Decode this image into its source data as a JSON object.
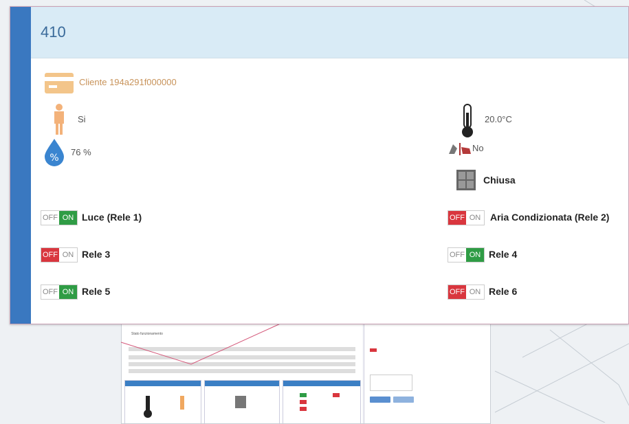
{
  "card": {
    "title": "410",
    "client": "Cliente 194a291f000000",
    "presence": "Si",
    "temperature": "20.0°C",
    "humidity": "76 %",
    "window_open": "No",
    "door_state": "Chiusa"
  },
  "relays": [
    {
      "off": "OFF",
      "on": "ON",
      "label": "Luce (Rele 1)",
      "state": "on"
    },
    {
      "off": "OFF",
      "on": "ON",
      "label": "Aria Condizionata (Rele 2)",
      "state": "off"
    },
    {
      "off": "OFF",
      "on": "ON",
      "label": "Rele 3",
      "state": "off"
    },
    {
      "off": "OFF",
      "on": "ON",
      "label": "Rele 4",
      "state": "on"
    },
    {
      "off": "OFF",
      "on": "ON",
      "label": "Rele 5",
      "state": "on"
    },
    {
      "off": "OFF",
      "on": "ON",
      "label": "Rele 6",
      "state": "off"
    }
  ],
  "colors": {
    "accent": "#3a78c0",
    "header_bg": "#d9ebf6",
    "off_red": "#d9363e",
    "on_green": "#2f9c45"
  },
  "icons": [
    "card-icon",
    "person-icon",
    "thermometer-icon",
    "humidity-drop-icon",
    "window-icon",
    "door-icon"
  ]
}
